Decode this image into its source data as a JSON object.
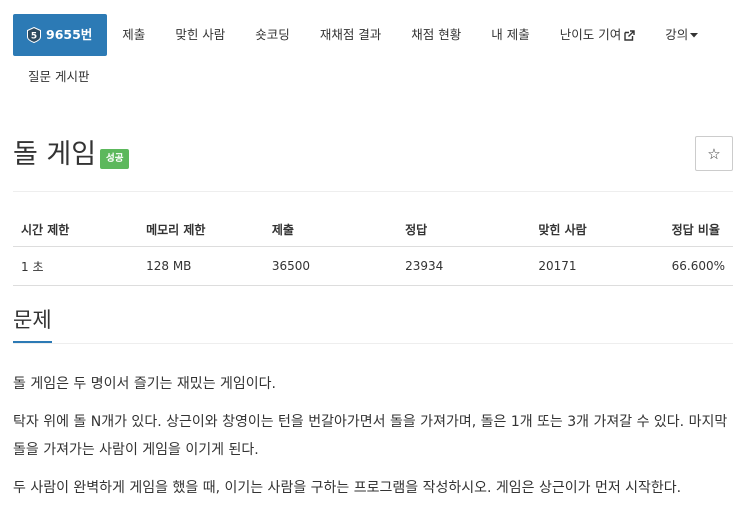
{
  "nav": {
    "problem_id": "9655번",
    "tier": {
      "number": "5",
      "color": "#2d4a60"
    },
    "row1": [
      {
        "label": "제출",
        "name": "tab-submit"
      },
      {
        "label": "맞힌 사람",
        "name": "tab-solvers"
      },
      {
        "label": "숏코딩",
        "name": "tab-short-coding"
      },
      {
        "label": "재채점 결과",
        "name": "tab-rejudge-result"
      },
      {
        "label": "채점 현황",
        "name": "tab-judge-status"
      },
      {
        "label": "내 제출",
        "name": "tab-my-submissions"
      },
      {
        "label": "난이도 기여",
        "name": "tab-difficulty-contribution",
        "icon": "external-link-icon"
      },
      {
        "label": "강의",
        "name": "tab-lectures",
        "icon": "caret-down-icon"
      }
    ],
    "row2": [
      {
        "label": "질문 게시판",
        "name": "tab-question-board"
      }
    ],
    "accent_color": "#2c7ab5"
  },
  "title": {
    "text": "돌 게임",
    "badge": "성공",
    "badge_color": "#5cb85c",
    "star_icon": "star-icon",
    "star_glyph": "☆"
  },
  "info_table": {
    "headers": [
      "시간 제한",
      "메모리 제한",
      "제출",
      "정답",
      "맞힌 사람",
      "정답 비율"
    ],
    "row": [
      "1 초",
      "128 MB",
      "36500",
      "23934",
      "20171",
      "66.600%"
    ]
  },
  "section": {
    "title": "문제"
  },
  "description": [
    "돌 게임은 두 명이서 즐기는 재밌는 게임이다.",
    "탁자 위에 돌 N개가 있다. 상근이와 창영이는 턴을 번갈아가면서 돌을 가져가며, 돌은 1개 또는 3개 가져갈 수 있다. 마지막 돌을 가져가는 사람이 게임을 이기게 된다.",
    "두 사람이 완벽하게 게임을 했을 때, 이기는 사람을 구하는 프로그램을 작성하시오. 게임은 상근이가 먼저 시작한다."
  ]
}
